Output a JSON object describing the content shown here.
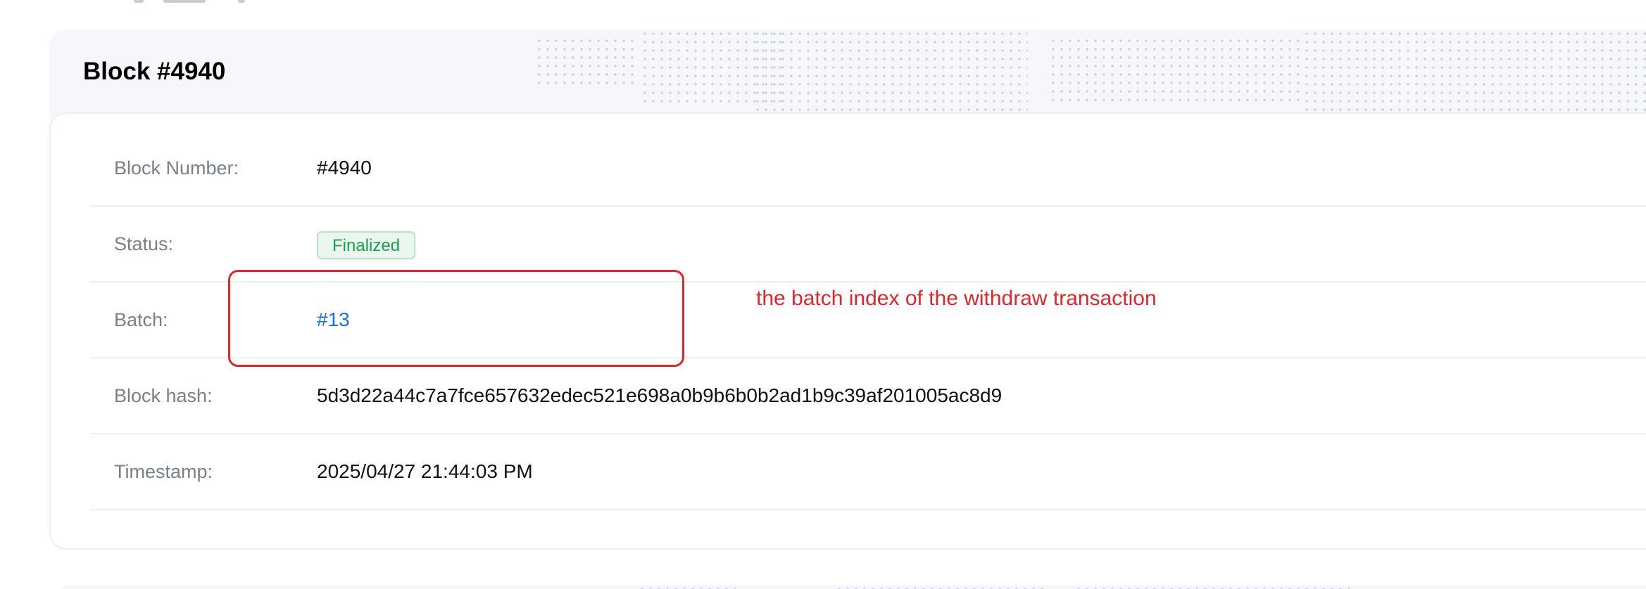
{
  "block": {
    "title": "Block #4940"
  },
  "details": {
    "rows": [
      {
        "label": "Block Number",
        "value": "#4940"
      },
      {
        "label": "Status",
        "value": "Finalized"
      },
      {
        "label": "Batch",
        "value": "#13"
      },
      {
        "label": "Block hash",
        "value": "5d3d22a44c7a7fce657632edec521e698a0b9b6b0b2ad1b9c39af201005ac8d9"
      },
      {
        "label": "Timestamp",
        "value": "2025/04/27 21:44:03 PM"
      }
    ],
    "label_suffix": ":"
  },
  "annotation": {
    "text": "the batch index of the withdraw transaction",
    "color": "#e0262b"
  },
  "colors": {
    "status_green": "#1e9e4a",
    "link_blue": "#1a6fe8",
    "label_gray": "#7b7f87",
    "card_bg": "#f6f7fa"
  }
}
